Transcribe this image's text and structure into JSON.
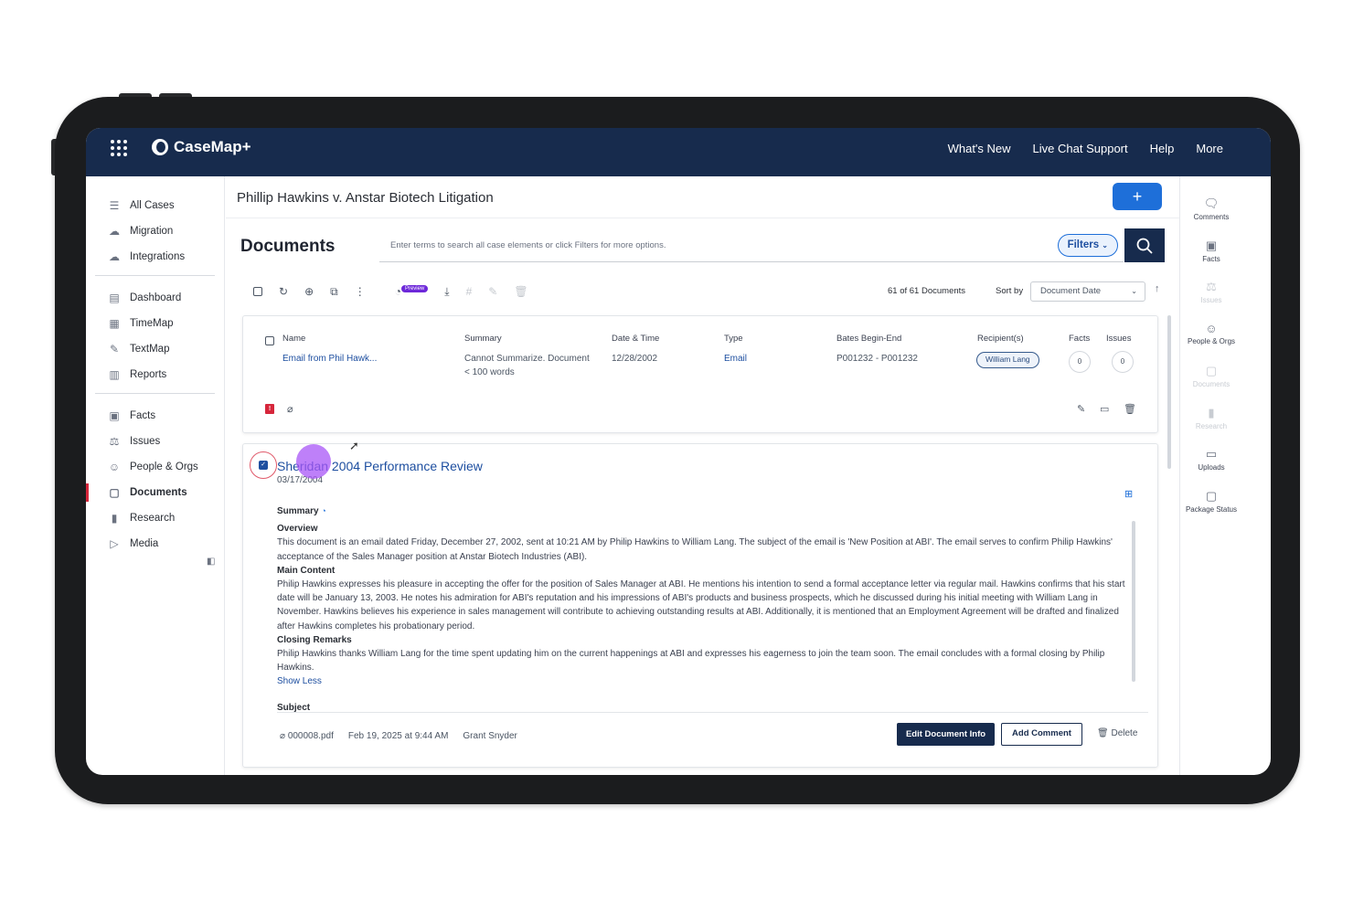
{
  "app": {
    "name": "CaseMap+",
    "topnav": [
      "What's New",
      "Live Chat Support",
      "Help",
      "More"
    ]
  },
  "sidebar": {
    "group1": [
      {
        "label": "All Cases",
        "icon": "list-icon"
      },
      {
        "label": "Migration",
        "icon": "cloud-icon"
      },
      {
        "label": "Integrations",
        "icon": "cloud-icon"
      }
    ],
    "group2": [
      {
        "label": "Dashboard",
        "icon": "dashboard-icon"
      },
      {
        "label": "TimeMap",
        "icon": "timemap-icon"
      },
      {
        "label": "TextMap",
        "icon": "textmap-icon"
      },
      {
        "label": "Reports",
        "icon": "reports-icon"
      }
    ],
    "group3": [
      {
        "label": "Facts",
        "icon": "facts-icon"
      },
      {
        "label": "Issues",
        "icon": "issues-icon"
      },
      {
        "label": "People & Orgs",
        "icon": "people-icon"
      },
      {
        "label": "Documents",
        "icon": "documents-icon",
        "active": true
      },
      {
        "label": "Research",
        "icon": "research-icon"
      },
      {
        "label": "Media",
        "icon": "media-icon"
      }
    ]
  },
  "case": {
    "title": "Phillip Hawkins v. Anstar Biotech Litigation",
    "add_label": "+"
  },
  "documents": {
    "title": "Documents",
    "search_placeholder": "Enter terms to search all case elements or click Filters for more options.",
    "filters_label": "Filters",
    "preview_badge": "Preview",
    "count": "61 of 61 Documents",
    "sort_label": "Sort by",
    "sort_value": "Document Date"
  },
  "table": {
    "headers": {
      "name": "Name",
      "summary": "Summary",
      "date": "Date & Time",
      "type": "Type",
      "bates": "Bates Begin-End",
      "recipients": "Recipient(s)",
      "facts": "Facts",
      "issues": "Issues"
    },
    "row": {
      "name": "Email from Phil Hawk...",
      "summary_line1": "Cannot Summarize. Document",
      "summary_line2": "< 100 words",
      "date": "12/28/2002",
      "type": "Email",
      "bates": "P001232 - P001232",
      "recipient": "William Lang",
      "facts": "0",
      "issues": "0"
    }
  },
  "detail": {
    "title": "Sheridan 2004 Performance Review",
    "date": "03/17/2004",
    "summary_label": "Summary",
    "overview_label": "Overview",
    "overview_text": "This document is an email dated Friday, December 27, 2002, sent at 10:21 AM by Philip Hawkins to William Lang. The subject of the email is 'New Position at ABI'. The email serves to confirm Philip Hawkins' acceptance of the Sales Manager position at Anstar Biotech Industries (ABI).",
    "main_label": "Main Content",
    "main_text": "Philip Hawkins expresses his pleasure in accepting the offer for the position of Sales Manager at ABI. He mentions his intention to send a formal acceptance letter via regular mail. Hawkins confirms that his start date will be January 13, 2003. He notes his admiration for ABI's reputation and his impressions of ABI's products and business prospects, which he discussed during his initial meeting with William Lang in November. Hawkins believes his experience in sales management will contribute to achieving outstanding results at ABI. Additionally, it is mentioned that an Employment Agreement will be drafted and finalized after Hawkins completes his probationary period.",
    "closing_label": "Closing Remarks",
    "closing_text": "Philip Hawkins thanks William Lang for the time spent updating him on the current happenings at ABI and expresses his eagerness to join the team soon. The email concludes with a formal closing by Philip Hawkins.",
    "show_less": "Show Less",
    "subject_label": "Subject",
    "file": "000008.pdf",
    "uploaded": "Feb 19, 2025 at 9:44 AM",
    "author": "Grant Snyder",
    "edit_label": "Edit Document Info",
    "comment_label": "Add Comment",
    "delete_label": "Delete"
  },
  "right_rail": [
    {
      "label": "Comments",
      "icon": "comments-icon",
      "enabled": true
    },
    {
      "label": "Facts",
      "icon": "facts-icon",
      "enabled": true
    },
    {
      "label": "Issues",
      "icon": "issues-icon",
      "enabled": false
    },
    {
      "label": "People & Orgs",
      "icon": "people-icon",
      "enabled": true
    },
    {
      "label": "Documents",
      "icon": "documents-icon",
      "enabled": false
    },
    {
      "label": "Research",
      "icon": "research-icon",
      "enabled": false
    },
    {
      "label": "Uploads",
      "icon": "uploads-icon",
      "enabled": true
    },
    {
      "label": "Package Status",
      "icon": "package-icon",
      "enabled": true
    }
  ],
  "colors": {
    "navy": "#172b4d",
    "accent": "#1e6fd9",
    "link": "#1e4fa0",
    "alert": "#d6263b",
    "touch": "#a855f7"
  }
}
